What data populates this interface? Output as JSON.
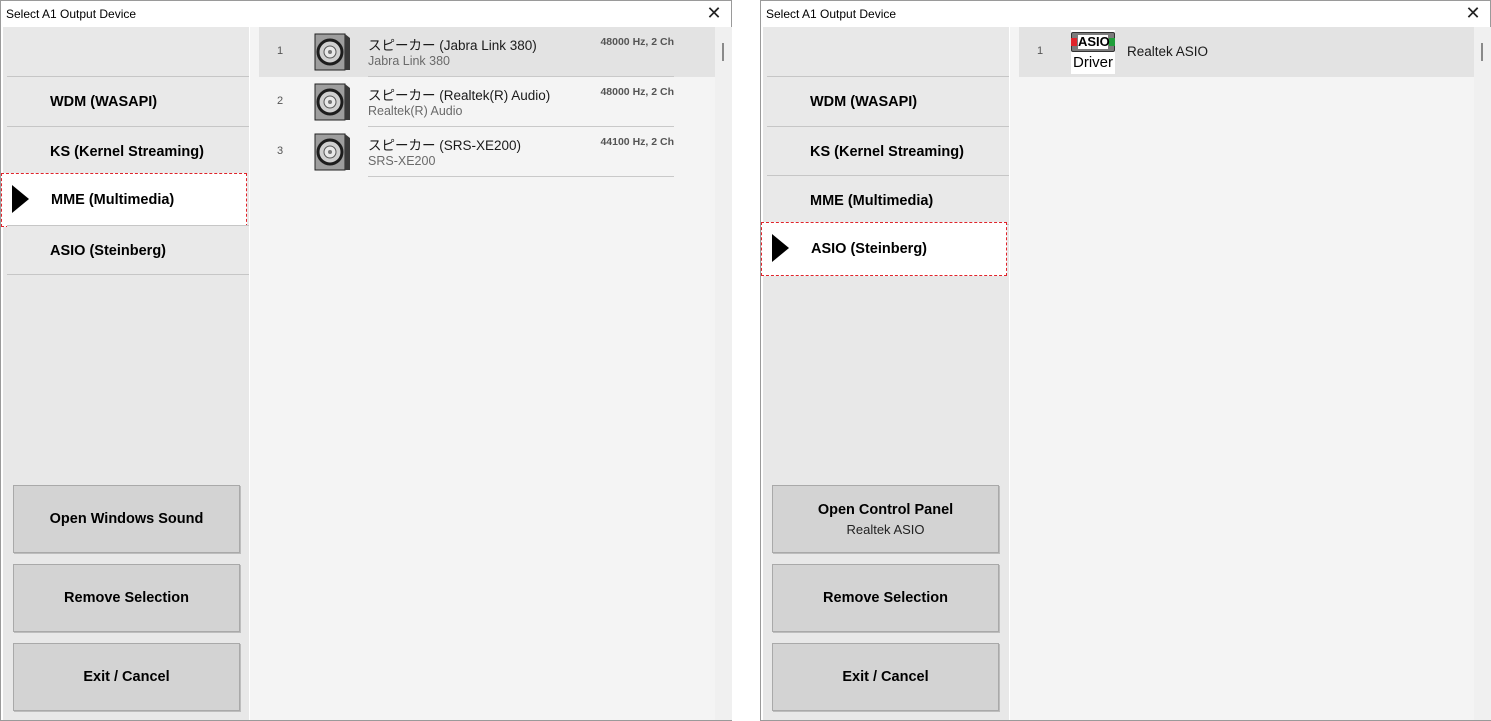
{
  "left_window": {
    "title": "Select A1 Output Device",
    "close_glyph": "✕",
    "tabs": [
      {
        "label": "WDM (WASAPI)",
        "active": false
      },
      {
        "label": "KS (Kernel Streaming)",
        "active": false
      },
      {
        "label": "MME (Multimedia)",
        "active": true
      },
      {
        "label": "ASIO (Steinberg)",
        "active": false
      }
    ],
    "buttons": {
      "open_sound": "Open Windows Sound",
      "remove": "Remove Selection",
      "exit": "Exit / Cancel"
    },
    "devices": [
      {
        "num": "1",
        "name": "スピーカー (Jabra Link 380)",
        "device": "Jabra Link 380",
        "format": "48000 Hz, 2 Ch",
        "selected": true,
        "icon": "speaker-icon"
      },
      {
        "num": "2",
        "name": "スピーカー (Realtek(R) Audio)",
        "device": "Realtek(R) Audio",
        "format": "48000 Hz, 2 Ch",
        "selected": false,
        "icon": "speaker-icon"
      },
      {
        "num": "3",
        "name": "スピーカー (SRS-XE200)",
        "device": "SRS-XE200",
        "format": "44100 Hz, 2 Ch",
        "selected": false,
        "icon": "speaker-icon"
      }
    ]
  },
  "right_window": {
    "title": "Select A1 Output Device",
    "close_glyph": "✕",
    "tabs": [
      {
        "label": "WDM (WASAPI)",
        "active": false
      },
      {
        "label": "KS (Kernel Streaming)",
        "active": false
      },
      {
        "label": "MME (Multimedia)",
        "active": false
      },
      {
        "label": "ASIO (Steinberg)",
        "active": true
      }
    ],
    "buttons": {
      "open_control_panel": "Open Control Panel",
      "open_control_panel_sub": "Realtek ASIO",
      "remove": "Remove Selection",
      "exit": "Exit / Cancel"
    },
    "devices": [
      {
        "num": "1",
        "name": "Realtek ASIO",
        "selected": true,
        "icon": "asio-driver-icon",
        "logo_top": "ASIO",
        "logo_bottom": "Driver"
      }
    ]
  },
  "colors": {
    "highlight_border": "#e0242b",
    "sidebar_bg": "#e8e8e8",
    "button_bg": "#d3d3d3",
    "list_bg": "#f4f4f4"
  }
}
